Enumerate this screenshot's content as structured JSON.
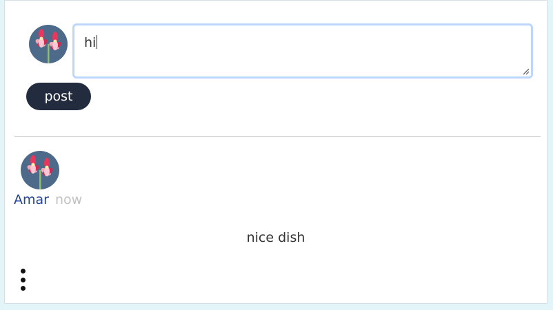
{
  "composer": {
    "input_value": "hi",
    "post_label": "post"
  },
  "comment": {
    "author": "Amar",
    "timestamp": "now",
    "text": "nice dish"
  },
  "icons": {
    "composer_avatar": "flower-avatar-icon",
    "comment_avatar": "flower-avatar-icon",
    "more_options": "more-vertical-icon"
  },
  "colors": {
    "page_background": "#e3f5f8",
    "post_button": "#232b3e",
    "author_link": "#24449a",
    "timestamp": "#c2c2c2",
    "input_focus_border": "#bcd7fb",
    "avatar_background": "#4d6a8a"
  }
}
